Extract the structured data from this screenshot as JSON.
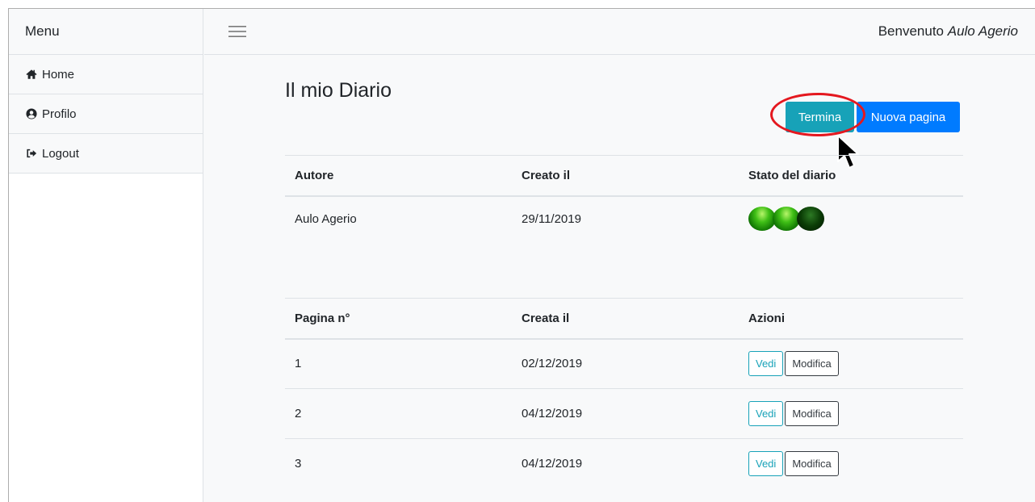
{
  "sidebar": {
    "heading": "Menu",
    "items": [
      {
        "label": "Home",
        "icon": "home-icon"
      },
      {
        "label": "Profilo",
        "icon": "user-circle-icon"
      },
      {
        "label": "Logout",
        "icon": "sign-out-icon"
      }
    ]
  },
  "navbar": {
    "welcome_prefix": "Benvenuto ",
    "user_name": "Aulo Agerio"
  },
  "main": {
    "title": "Il mio Diario",
    "termina_label": "Termina",
    "nuova_label": "Nuova pagina"
  },
  "diary_table": {
    "headers": [
      "Autore",
      "Creato il",
      "Stato del diario"
    ],
    "row": {
      "autore": "Aulo Agerio",
      "creato": "29/11/2019"
    },
    "lights": [
      "on",
      "on",
      "off"
    ]
  },
  "pages_table": {
    "headers": [
      "Pagina n°",
      "Creata il",
      "Azioni"
    ],
    "rows": [
      {
        "num": "1",
        "date": "02/12/2019"
      },
      {
        "num": "2",
        "date": "04/12/2019"
      },
      {
        "num": "3",
        "date": "04/12/2019"
      }
    ],
    "view_label": "Vedi",
    "edit_label": "Modifica"
  },
  "colors": {
    "info": "#17a2b8",
    "primary": "#007bff",
    "highlight": "#e4181f"
  }
}
